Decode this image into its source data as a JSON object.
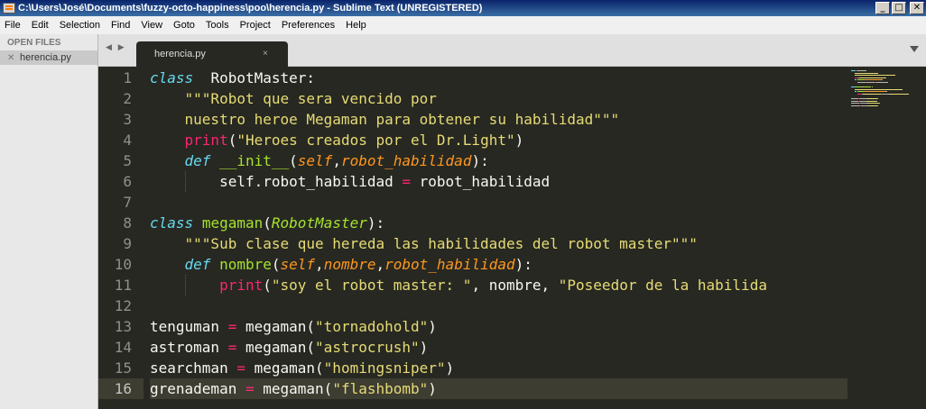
{
  "window": {
    "title": "C:\\Users\\José\\Documents\\fuzzy-octo-happiness\\poo\\herencia.py - Sublime Text (UNREGISTERED)",
    "buttons": {
      "minimize": "_",
      "maximize": "□",
      "close": "✕"
    }
  },
  "menu": {
    "items": [
      "File",
      "Edit",
      "Selection",
      "Find",
      "View",
      "Goto",
      "Tools",
      "Project",
      "Preferences",
      "Help"
    ]
  },
  "sidebar": {
    "header": "OPEN FILES",
    "files": [
      {
        "name": "herencia.py"
      }
    ]
  },
  "tabs": [
    {
      "label": "herencia.py",
      "close": "×"
    }
  ],
  "tab_nav": "◀ ▶",
  "editor": {
    "current_line": 16,
    "line_numbers": [
      "1",
      "2",
      "3",
      "4",
      "5",
      "6",
      "7",
      "8",
      "9",
      "10",
      "11",
      "12",
      "13",
      "14",
      "15",
      "16"
    ],
    "lines": [
      [
        [
          "kw",
          "class"
        ],
        [
          "",
          "  "
        ],
        [
          "",
          "RobotMaster:"
        ]
      ],
      [
        [
          "",
          "    "
        ],
        [
          "str",
          "\"\"\"Robot que sera vencido por"
        ]
      ],
      [
        [
          "",
          "    "
        ],
        [
          "str",
          "nuestro heroe Megaman para obtener su habilidad\"\"\""
        ]
      ],
      [
        [
          "",
          "    "
        ],
        [
          "fn",
          "print"
        ],
        [
          "",
          "("
        ],
        [
          "str",
          "\"Heroes creados por el Dr.Light\""
        ],
        [
          "",
          ")"
        ]
      ],
      [
        [
          "",
          "    "
        ],
        [
          "kw",
          "def"
        ],
        [
          "",
          " "
        ],
        [
          "cls",
          "__init__"
        ],
        [
          "",
          "("
        ],
        [
          "par",
          "self"
        ],
        [
          "",
          ","
        ],
        [
          "par",
          "robot_habilidad"
        ],
        [
          "",
          "):"
        ]
      ],
      [
        [
          "",
          "        "
        ],
        [
          "",
          "self.robot_habilidad "
        ],
        [
          "op",
          "="
        ],
        [
          "",
          " robot_habilidad"
        ]
      ],
      [],
      [
        [
          "kw",
          "class"
        ],
        [
          "",
          " "
        ],
        [
          "cls",
          "megaman"
        ],
        [
          "",
          "("
        ],
        [
          "inh",
          "RobotMaster"
        ],
        [
          "",
          "):"
        ]
      ],
      [
        [
          "",
          "    "
        ],
        [
          "str",
          "\"\"\"Sub clase que hereda las habilidades del robot master\"\"\""
        ]
      ],
      [
        [
          "",
          "    "
        ],
        [
          "kw",
          "def"
        ],
        [
          "",
          " "
        ],
        [
          "cls",
          "nombre"
        ],
        [
          "",
          "("
        ],
        [
          "par",
          "self"
        ],
        [
          "",
          ","
        ],
        [
          "par",
          "nombre"
        ],
        [
          "",
          ","
        ],
        [
          "par",
          "robot_habilidad"
        ],
        [
          "",
          "):"
        ]
      ],
      [
        [
          "",
          "        "
        ],
        [
          "fn",
          "print"
        ],
        [
          "",
          "("
        ],
        [
          "str",
          "\"soy el robot master: \""
        ],
        [
          "",
          ", nombre, "
        ],
        [
          "str",
          "\"Poseedor de la habilida"
        ]
      ],
      [],
      [
        [
          "",
          "tenguman "
        ],
        [
          "op",
          "="
        ],
        [
          "",
          " megaman("
        ],
        [
          "str",
          "\"tornadohold\""
        ],
        [
          "",
          ")"
        ]
      ],
      [
        [
          "",
          "astroman "
        ],
        [
          "op",
          "="
        ],
        [
          "",
          " megaman("
        ],
        [
          "str",
          "\"astrocrush\""
        ],
        [
          "",
          ")"
        ]
      ],
      [
        [
          "",
          "searchman "
        ],
        [
          "op",
          "="
        ],
        [
          "",
          " megaman("
        ],
        [
          "str",
          "\"homingsniper\""
        ],
        [
          "",
          ")"
        ]
      ],
      [
        [
          "",
          "grenademan "
        ],
        [
          "op",
          "="
        ],
        [
          "",
          " megaman("
        ],
        [
          "str",
          "\"flashbomb\""
        ],
        [
          "",
          ")"
        ]
      ]
    ]
  },
  "colors": {
    "background": "#272822",
    "keyword": "#66d9ef",
    "class_name": "#a6e22e",
    "string": "#e6db74",
    "builtin": "#f92672",
    "parameter": "#fd971f",
    "text": "#f8f8f2",
    "line_number": "#90908a"
  }
}
